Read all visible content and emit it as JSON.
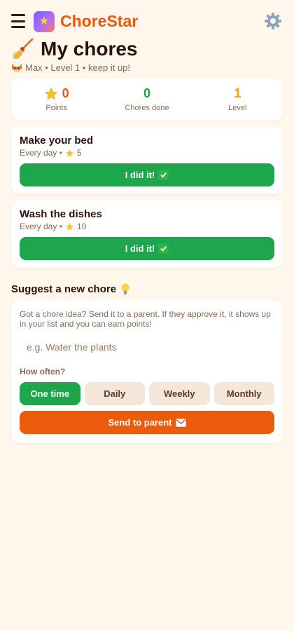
{
  "header": {
    "app_title": "ChoreStar",
    "menu_icon": "hamburger-menu-icon",
    "logo_icon": "star-logo-icon",
    "settings_icon": "gear-icon"
  },
  "page": {
    "title": "My chores",
    "title_icon": "broom-icon",
    "subtitle": "Max • Level 1 • keep it up!",
    "subtitle_icon": "fox-icon"
  },
  "stats": [
    {
      "value": "0",
      "label": "Points",
      "icon": "star-icon",
      "color": "#e8590c"
    },
    {
      "value": "0",
      "label": "Chores done",
      "color": "#1f9d48"
    },
    {
      "value": "1",
      "label": "Level",
      "color": "#f59f00"
    }
  ],
  "chores": [
    {
      "title": "Make your bed",
      "frequency": "Every day •",
      "points": "5",
      "button_label": "I did it!"
    },
    {
      "title": "Wash the dishes",
      "frequency": "Every day •",
      "points": "10",
      "button_label": "I did it!"
    }
  ],
  "suggest": {
    "heading": "Suggest a new chore",
    "description": "Got a chore idea? Send it to a parent. If they approve it, it shows up in your list and you can earn points!",
    "input_placeholder": "e.g. Water the plants",
    "input_value": "",
    "frequency_label": "How often?",
    "frequency_options": [
      "One time",
      "Daily",
      "Weekly",
      "Monthly"
    ],
    "selected_frequency": "One time",
    "send_label": "Send to parent"
  },
  "colors": {
    "background": "#fff6ec",
    "brand": "#e8590c",
    "success": "#1ea64c",
    "send": "#ec5a0c"
  }
}
